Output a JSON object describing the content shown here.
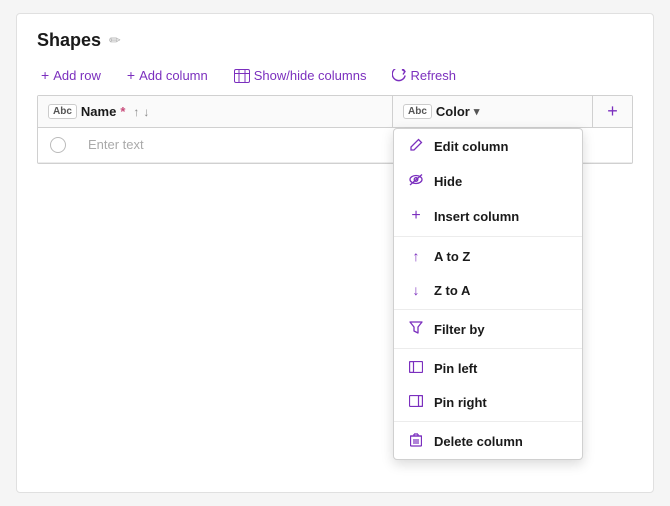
{
  "header": {
    "title": "Shapes",
    "edit_icon": "✏"
  },
  "toolbar": {
    "add_row": "Add row",
    "add_column": "Add column",
    "show_hide": "Show/hide columns",
    "refresh": "Refresh"
  },
  "table": {
    "col_name_badge": "Abc",
    "col_name_label": "Name",
    "col_name_required": "*",
    "col_color_badge": "Abc",
    "col_color_label": "Color",
    "add_col_icon": "+",
    "row_placeholder": "Enter text"
  },
  "dropdown": {
    "items": [
      {
        "id": "edit-column",
        "icon": "✎",
        "label": "Edit column"
      },
      {
        "id": "hide",
        "icon": "👁",
        "label": "Hide"
      },
      {
        "id": "insert-column",
        "icon": "+",
        "label": "Insert column"
      },
      {
        "id": "a-to-z",
        "icon": "↑",
        "label": "A to Z"
      },
      {
        "id": "z-to-a",
        "icon": "↓",
        "label": "Z to A"
      },
      {
        "id": "filter-by",
        "icon": "▽",
        "label": "Filter by"
      },
      {
        "id": "pin-left",
        "icon": "▣",
        "label": "Pin left"
      },
      {
        "id": "pin-right",
        "icon": "▣",
        "label": "Pin right"
      },
      {
        "id": "delete-column",
        "icon": "🗑",
        "label": "Delete column"
      }
    ]
  }
}
